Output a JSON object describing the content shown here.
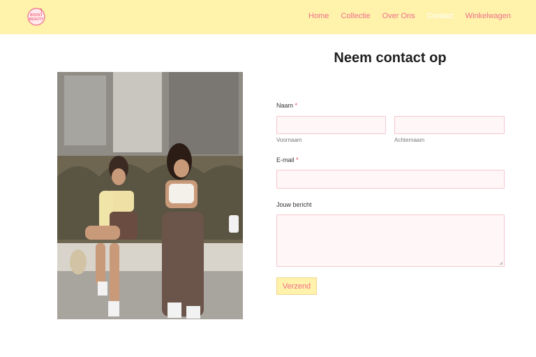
{
  "header": {
    "logo_text": "BOOST BEAUTY",
    "nav": [
      "Home",
      "Collectie",
      "Over Ons",
      "Contact",
      "Winkelwagen"
    ],
    "active_nav": "Contact"
  },
  "page": {
    "title": "Neem contact op"
  },
  "form": {
    "name_label": "Naam",
    "required_mark": "*",
    "first_name_sub": "Voornaam",
    "last_name_sub": "Achternaam",
    "email_label": "E-mail",
    "message_label": "Jouw bericht",
    "submit_label": "Verzend"
  },
  "colors": {
    "header_bg": "#fff2ab",
    "accent": "#ef6f8a",
    "field_border": "#f6c7d0",
    "field_bg": "#fff7f7"
  }
}
